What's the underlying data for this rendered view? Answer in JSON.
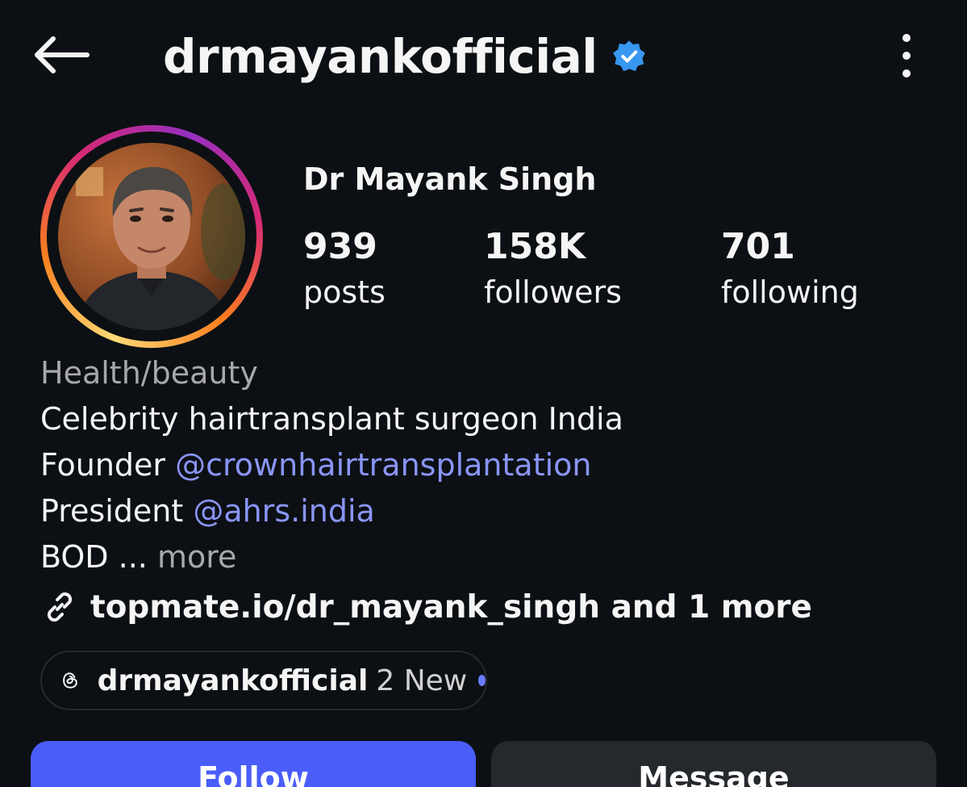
{
  "header": {
    "username": "drmayankofficial",
    "back_icon": "back-arrow-icon",
    "verified_icon": "verified-badge-icon",
    "more_icon": "more-vertical-icon",
    "verified_color": "#3897f0"
  },
  "profile": {
    "display_name": "Dr Mayank Singh",
    "stats": {
      "posts": {
        "value": "939",
        "label": "posts"
      },
      "followers": {
        "value": "158K",
        "label": "followers"
      },
      "following": {
        "value": "701",
        "label": "following"
      }
    }
  },
  "bio": {
    "category": "Health/beauty",
    "line1": "Celebrity hairtransplant surgeon India",
    "line2_prefix": "Founder ",
    "line2_mention": "@crownhairtransplantation",
    "line3_prefix": "President ",
    "line3_mention": "@ahrs.india",
    "line4_text": "BOD ...",
    "line4_more": "more",
    "mention_color": "#8a95f8"
  },
  "link": {
    "icon": "link-icon",
    "text": "topmate.io/dr_mayank_singh and 1 more"
  },
  "threads": {
    "icon": "threads-icon",
    "username": "drmayankofficial",
    "badge": "2 New"
  },
  "actions": {
    "follow_label": "Follow",
    "message_label": "Message",
    "follow_color": "#4a5df9"
  }
}
